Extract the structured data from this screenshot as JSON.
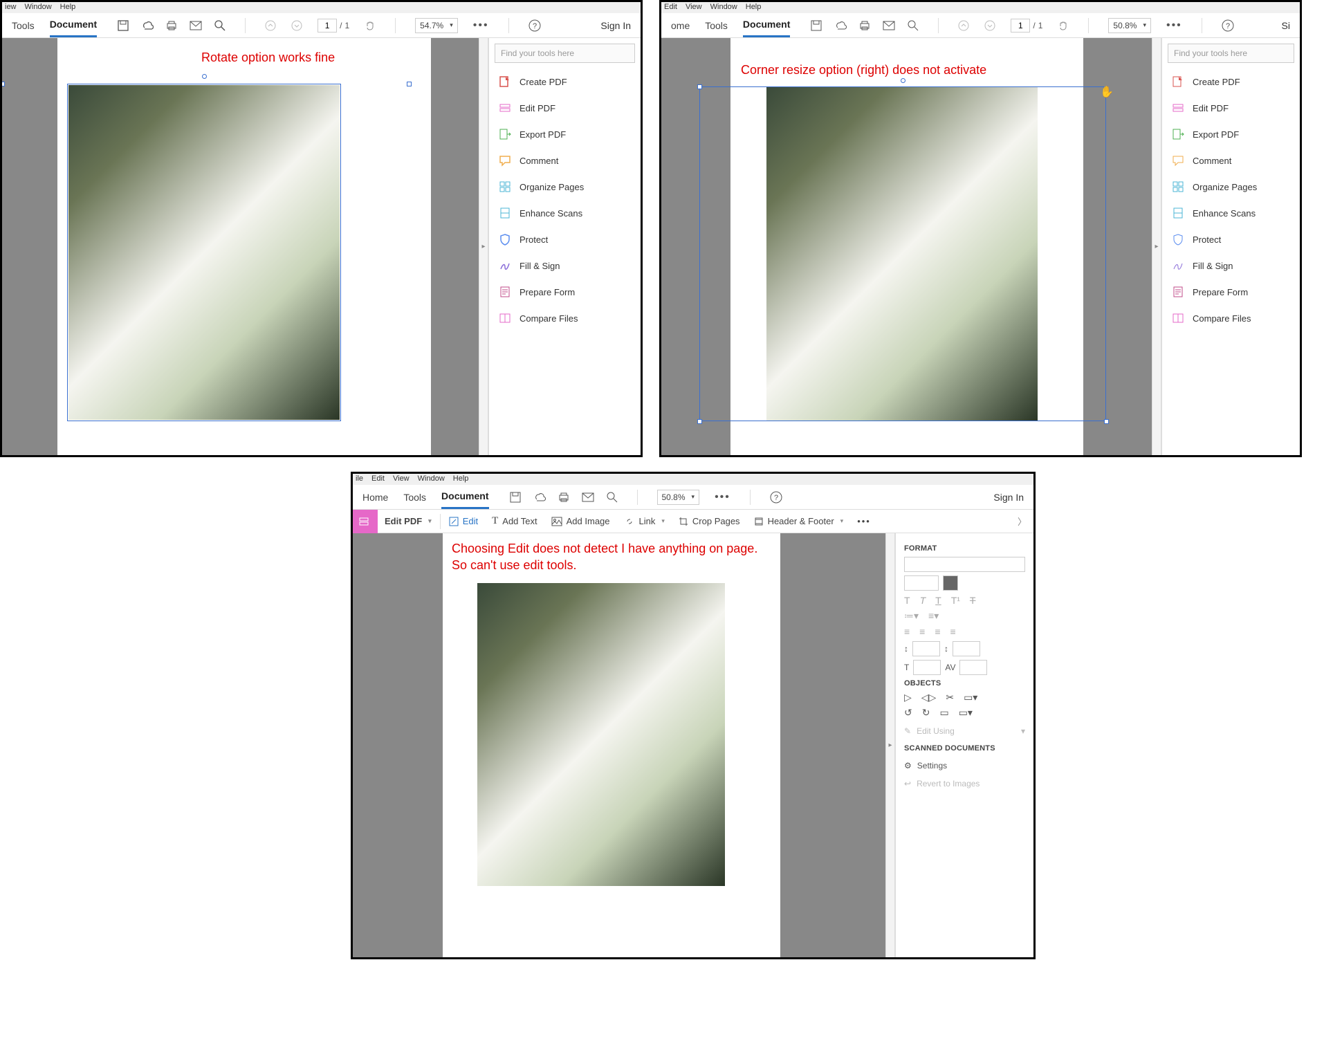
{
  "win1": {
    "menus": [
      "iew",
      "Window",
      "Help"
    ],
    "tabs": {
      "tools": "Tools",
      "document": "Document"
    },
    "page": {
      "current": "1",
      "total": "1"
    },
    "zoom": "54.7%",
    "signin": "Sign In",
    "note": "Rotate option works fine",
    "search_ph": "Find your tools here",
    "tools": [
      {
        "label": "Create PDF",
        "color": "#d9534f"
      },
      {
        "label": "Edit PDF",
        "color": "#e668c8"
      },
      {
        "label": "Export PDF",
        "color": "#5cb85c"
      },
      {
        "label": "Comment",
        "color": "#f0ad4e"
      },
      {
        "label": "Organize Pages",
        "color": "#4bb6d6"
      },
      {
        "label": "Enhance Scans",
        "color": "#4bb6d6"
      },
      {
        "label": "Protect",
        "color": "#5b8def"
      },
      {
        "label": "Fill & Sign",
        "color": "#8a6dd9"
      },
      {
        "label": "Prepare Form",
        "color": "#c14b8a"
      },
      {
        "label": "Compare Files",
        "color": "#e668c8"
      }
    ]
  },
  "win2": {
    "menus": [
      "Edit",
      "View",
      "Window",
      "Help"
    ],
    "tabs": {
      "home": "ome",
      "tools": "Tools",
      "document": "Document"
    },
    "page": {
      "current": "1",
      "total": "1"
    },
    "zoom": "50.8%",
    "signin": "Si",
    "note": "Corner resize option (right) does not activate",
    "search_ph": "Find your tools here",
    "tools": [
      {
        "label": "Create PDF"
      },
      {
        "label": "Edit PDF"
      },
      {
        "label": "Export PDF"
      },
      {
        "label": "Comment"
      },
      {
        "label": "Organize Pages"
      },
      {
        "label": "Enhance Scans"
      },
      {
        "label": "Protect"
      },
      {
        "label": "Fill & Sign"
      },
      {
        "label": "Prepare Form"
      },
      {
        "label": "Compare Files"
      }
    ]
  },
  "win3": {
    "menus": [
      "ile",
      "Edit",
      "View",
      "Window",
      "Help"
    ],
    "tabs": {
      "home": "Home",
      "tools": "Tools",
      "document": "Document"
    },
    "zoom": "50.8%",
    "signin": "Sign In",
    "editpdf": "Edit PDF",
    "sub": {
      "edit": "Edit",
      "addtext": "Add Text",
      "addimage": "Add Image",
      "link": "Link",
      "crop": "Crop Pages",
      "header": "Header & Footer"
    },
    "note": "Choosing Edit does not detect I have anything on page. So can't use edit tools.",
    "format": "FORMAT",
    "objects": "OBJECTS",
    "editusing": "Edit Using",
    "scanned": "SCANNED DOCUMENTS",
    "settings": "Settings",
    "revert": "Revert to Images"
  }
}
